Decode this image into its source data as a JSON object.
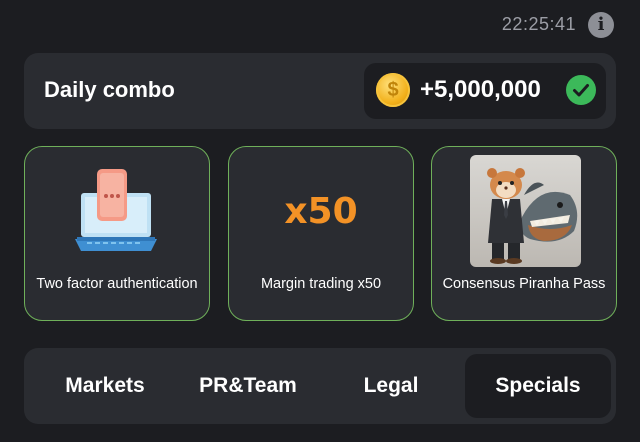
{
  "status": {
    "time": "22:25:41",
    "info_icon": "info-icon"
  },
  "daily_combo": {
    "title": "Daily combo",
    "reward": "+5,000,000",
    "coin_icon": "coin-icon",
    "coin_symbol": "$",
    "check_icon": "check-circle-icon",
    "colors": {
      "coin": "#f2b01a",
      "check": "#3cb95a"
    }
  },
  "cards": [
    {
      "label": "Two factor authentication",
      "image": "laptop-phone-illustration",
      "completed": true
    },
    {
      "label": "Margin trading x50",
      "badge": "x50",
      "completed": false
    },
    {
      "label": "Consensus Piranha Pass",
      "image": "hamster-piranha-photo",
      "completed": true
    }
  ],
  "tabs": [
    {
      "label": "Markets",
      "selected": false
    },
    {
      "label": "PR&Team",
      "selected": false
    },
    {
      "label": "Legal",
      "selected": false
    },
    {
      "label": "Specials",
      "selected": true
    }
  ],
  "colors": {
    "background": "#1c1d21",
    "surface": "#2a2c31",
    "completed_border": "#6fb05a",
    "accent_orange": "#f39226"
  }
}
